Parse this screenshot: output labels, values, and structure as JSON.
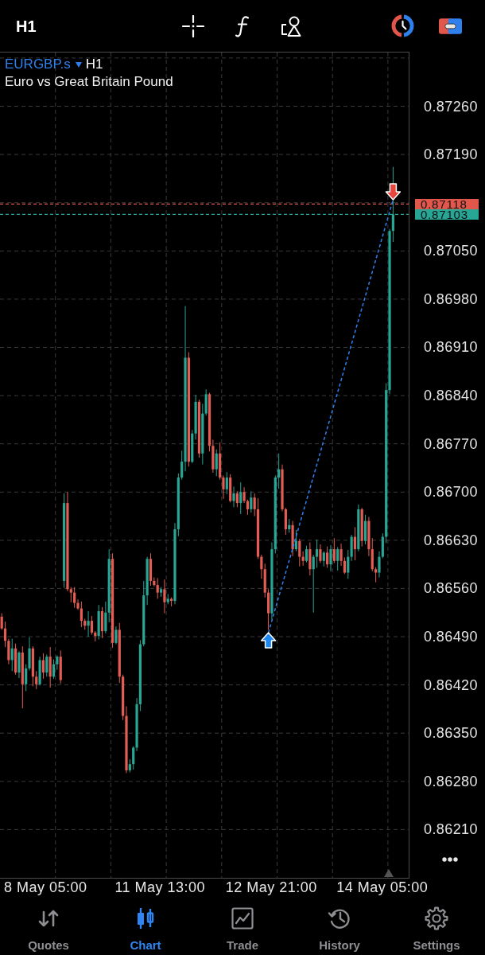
{
  "top_bar": {
    "timeframe": "H1"
  },
  "chart": {
    "symbol": "EURGBP.s",
    "timeframe": "H1",
    "description": "Euro vs Great Britain Pound",
    "chart_data": {
      "type": "candlestick",
      "grid": true,
      "ylim": [
        0.8614,
        0.87338
      ],
      "yticks": [
        {
          "value": 0.8726,
          "label": "0.87260"
        },
        {
          "value": 0.8719,
          "label": "0.87190"
        },
        {
          "value": 0.8705,
          "label": "0.87050"
        },
        {
          "value": 0.8698,
          "label": "0.86980"
        },
        {
          "value": 0.8691,
          "label": "0.86910"
        },
        {
          "value": 0.8684,
          "label": "0.86840"
        },
        {
          "value": 0.8677,
          "label": "0.86770"
        },
        {
          "value": 0.867,
          "label": "0.86700"
        },
        {
          "value": 0.8663,
          "label": "0.86630"
        },
        {
          "value": 0.8656,
          "label": "0.86560"
        },
        {
          "value": 0.8649,
          "label": "0.86490"
        },
        {
          "value": 0.8642,
          "label": "0.86420"
        },
        {
          "value": 0.8635,
          "label": "0.86350"
        },
        {
          "value": 0.8628,
          "label": "0.86280"
        },
        {
          "value": 0.8621,
          "label": "0.86210"
        }
      ],
      "ref_lines": [
        {
          "axis": "y",
          "value": 0.87118,
          "label": "0.87118",
          "color": "#e2574c"
        },
        {
          "axis": "y",
          "value": 0.87103,
          "label": "0.87103",
          "color": "#27a696"
        }
      ],
      "categories": [
        null,
        null,
        null,
        null,
        null,
        null,
        null,
        null,
        null,
        null,
        null,
        null,
        null,
        null,
        null,
        null,
        null,
        null,
        null,
        null,
        null,
        null,
        null,
        null,
        null,
        null,
        null,
        null,
        null,
        null,
        null,
        null,
        null,
        null,
        null,
        null,
        null,
        null,
        null,
        null,
        null,
        null,
        null,
        null,
        null,
        null,
        null,
        null,
        null,
        null,
        null,
        null,
        null,
        null,
        null,
        null,
        null,
        null,
        null,
        null,
        null,
        null,
        null,
        null,
        null,
        null,
        null,
        null,
        null,
        null,
        null,
        null,
        null,
        null,
        null,
        null,
        null,
        null,
        null,
        null,
        null,
        null,
        null,
        null,
        null,
        null,
        null,
        null,
        null,
        null,
        null,
        null,
        null,
        null,
        null,
        null,
        null,
        null,
        null,
        null,
        null,
        null,
        null,
        null,
        null,
        null,
        null,
        null,
        null,
        null,
        null,
        null,
        null,
        null,
        null,
        null,
        null,
        null
      ],
      "ohlc": [
        [
          0.86519,
          0.86524,
          0.865,
          0.86502
        ],
        [
          0.86502,
          0.86512,
          0.86475,
          0.86484
        ],
        [
          0.86484,
          0.86487,
          0.8645,
          0.86456
        ],
        [
          0.86456,
          0.86487,
          0.8644,
          0.86473
        ],
        [
          0.86473,
          0.8648,
          0.86435,
          0.86438
        ],
        [
          0.86438,
          0.86469,
          0.8643,
          0.86467
        ],
        [
          0.86467,
          0.86476,
          0.86386,
          0.86421
        ],
        [
          0.86421,
          0.8645,
          0.86411,
          0.86444
        ],
        [
          0.86444,
          0.86489,
          0.86441,
          0.86473
        ],
        [
          0.86473,
          0.86476,
          0.86418,
          0.86432
        ],
        [
          0.86432,
          0.8644,
          0.86414,
          0.86421
        ],
        [
          0.86421,
          0.86461,
          0.86419,
          0.86456
        ],
        [
          0.86456,
          0.86466,
          0.86429,
          0.86438
        ],
        [
          0.86438,
          0.86464,
          0.86432,
          0.86461
        ],
        [
          0.86461,
          0.86475,
          0.86416,
          0.86432
        ],
        [
          0.86432,
          0.86457,
          0.86429,
          0.8645
        ],
        [
          0.8645,
          0.86463,
          0.86442,
          0.86461
        ],
        [
          0.86461,
          0.8647,
          0.86422,
          0.86427
        ],
        [
          0.86571,
          0.86698,
          0.86561,
          0.86684
        ],
        [
          0.86684,
          0.867,
          0.86556,
          0.86559
        ],
        [
          0.86559,
          0.86562,
          0.8654,
          0.86554
        ],
        [
          0.86554,
          0.86562,
          0.86532,
          0.86539
        ],
        [
          0.86539,
          0.86544,
          0.86529,
          0.86531
        ],
        [
          0.86531,
          0.86541,
          0.86504,
          0.86513
        ],
        [
          0.86513,
          0.86516,
          0.865,
          0.86506
        ],
        [
          0.86506,
          0.86527,
          0.8649,
          0.86513
        ],
        [
          0.86513,
          0.8652,
          0.86493,
          0.86496
        ],
        [
          0.86496,
          0.86498,
          0.86483,
          0.86491
        ],
        [
          0.86491,
          0.86536,
          0.86486,
          0.86527
        ],
        [
          0.86527,
          0.86533,
          0.86488,
          0.86498
        ],
        [
          0.86498,
          0.86541,
          0.86495,
          0.86525
        ],
        [
          0.86525,
          0.86617,
          0.86511,
          0.86603
        ],
        [
          0.86603,
          0.86611,
          0.86474,
          0.86481
        ],
        [
          0.86481,
          0.86505,
          0.86479,
          0.865
        ],
        [
          0.865,
          0.8651,
          0.86423,
          0.86432
        ],
        [
          0.86432,
          0.86435,
          0.86369,
          0.86375
        ],
        [
          0.86375,
          0.86389,
          0.86292,
          0.86296
        ],
        [
          0.86296,
          0.86312,
          0.86293,
          0.86305
        ],
        [
          0.86305,
          0.86331,
          0.86297,
          0.86329
        ],
        [
          0.86329,
          0.86401,
          0.86324,
          0.86392
        ],
        [
          0.86392,
          0.86485,
          0.86382,
          0.86479
        ],
        [
          0.86479,
          0.86571,
          0.86476,
          0.8655
        ],
        [
          0.8655,
          0.86606,
          0.86536,
          0.86603
        ],
        [
          0.86603,
          0.86611,
          0.86564,
          0.86571
        ],
        [
          0.86571,
          0.86576,
          0.86563,
          0.86565
        ],
        [
          0.86565,
          0.86575,
          0.86545,
          0.86554
        ],
        [
          0.86554,
          0.86562,
          0.86548,
          0.86559
        ],
        [
          0.86559,
          0.86573,
          0.86524,
          0.8654
        ],
        [
          0.8654,
          0.86552,
          0.86537,
          0.86545
        ],
        [
          0.86545,
          0.86547,
          0.86534,
          0.86542
        ],
        [
          0.86542,
          0.86655,
          0.86537,
          0.86646
        ],
        [
          0.86646,
          0.86727,
          0.86636,
          0.86721
        ],
        [
          0.86721,
          0.8676,
          0.86718,
          0.86744
        ],
        [
          0.86744,
          0.8697,
          0.8673,
          0.86895
        ],
        [
          0.86895,
          0.86903,
          0.86737,
          0.86744
        ],
        [
          0.86744,
          0.8679,
          0.86742,
          0.86785
        ],
        [
          0.86785,
          0.86841,
          0.86776,
          0.86831
        ],
        [
          0.86831,
          0.86834,
          0.8675,
          0.86756
        ],
        [
          0.86756,
          0.86828,
          0.8674,
          0.86814
        ],
        [
          0.86814,
          0.86849,
          0.86811,
          0.86842
        ],
        [
          0.86842,
          0.86844,
          0.86759,
          0.86767
        ],
        [
          0.86767,
          0.86776,
          0.86728,
          0.86733
        ],
        [
          0.86733,
          0.86762,
          0.86723,
          0.86756
        ],
        [
          0.86756,
          0.86772,
          0.86718,
          0.86721
        ],
        [
          0.86721,
          0.86724,
          0.8669,
          0.86704
        ],
        [
          0.86704,
          0.86729,
          0.86697,
          0.86721
        ],
        [
          0.86721,
          0.86726,
          0.86685,
          0.86687
        ],
        [
          0.86687,
          0.86708,
          0.86678,
          0.86698
        ],
        [
          0.86698,
          0.86701,
          0.86678,
          0.86684
        ],
        [
          0.86684,
          0.86714,
          0.86668,
          0.867
        ],
        [
          0.867,
          0.86707,
          0.86684,
          0.86687
        ],
        [
          0.86687,
          0.86689,
          0.86667,
          0.86675
        ],
        [
          0.86675,
          0.86701,
          0.8667,
          0.86692
        ],
        [
          0.86692,
          0.86698,
          0.86665,
          0.86675
        ],
        [
          0.86675,
          0.86691,
          0.86603,
          0.86606
        ],
        [
          0.86606,
          0.86609,
          0.86574,
          0.86588
        ],
        [
          0.86588,
          0.86596,
          0.86547,
          0.86554
        ],
        [
          0.86554,
          0.86559,
          0.865,
          0.86524
        ],
        [
          0.86524,
          0.86627,
          0.86515,
          0.86617
        ],
        [
          0.86617,
          0.86724,
          0.86611,
          0.86721
        ],
        [
          0.86721,
          0.86756,
          0.86705,
          0.86733
        ],
        [
          0.86733,
          0.8674,
          0.86672,
          0.86675
        ],
        [
          0.86675,
          0.86677,
          0.86638,
          0.86646
        ],
        [
          0.86646,
          0.86661,
          0.86641,
          0.86652
        ],
        [
          0.86652,
          0.86658,
          0.86607,
          0.86617
        ],
        [
          0.86617,
          0.86645,
          0.86614,
          0.86629
        ],
        [
          0.86629,
          0.86632,
          0.86592,
          0.86606
        ],
        [
          0.86606,
          0.86614,
          0.86593,
          0.866
        ],
        [
          0.866,
          0.86622,
          0.86598,
          0.86617
        ],
        [
          0.86617,
          0.86627,
          0.86579,
          0.86588
        ],
        [
          0.86588,
          0.86609,
          0.86525,
          0.86606
        ],
        [
          0.86606,
          0.86631,
          0.8659,
          0.86617
        ],
        [
          0.86617,
          0.86624,
          0.86597,
          0.866
        ],
        [
          0.866,
          0.86614,
          0.86592,
          0.86612
        ],
        [
          0.86612,
          0.86621,
          0.8659,
          0.86595
        ],
        [
          0.86595,
          0.86623,
          0.86585,
          0.86617
        ],
        [
          0.86617,
          0.86633,
          0.86597,
          0.866
        ],
        [
          0.866,
          0.8662,
          0.86586,
          0.86617
        ],
        [
          0.86617,
          0.86625,
          0.86593,
          0.866
        ],
        [
          0.866,
          0.86605,
          0.86581,
          0.86583
        ],
        [
          0.86583,
          0.86616,
          0.86574,
          0.86606
        ],
        [
          0.86606,
          0.86638,
          0.866,
          0.86635
        ],
        [
          0.86635,
          0.86649,
          0.86601,
          0.86617
        ],
        [
          0.86617,
          0.86682,
          0.86614,
          0.86675
        ],
        [
          0.86675,
          0.86677,
          0.86621,
          0.86629
        ],
        [
          0.86629,
          0.86667,
          0.86624,
          0.86658
        ],
        [
          0.86658,
          0.86664,
          0.86607,
          0.86617
        ],
        [
          0.86617,
          0.86633,
          0.86585,
          0.86588
        ],
        [
          0.86588,
          0.86591,
          0.86569,
          0.86583
        ],
        [
          0.86583,
          0.86614,
          0.86576,
          0.86606
        ],
        [
          0.86606,
          0.8664,
          0.86604,
          0.86635
        ],
        [
          0.86635,
          0.86858,
          0.86626,
          0.86848
        ],
        [
          0.86848,
          0.87082,
          0.86842,
          0.87079
        ],
        [
          0.87079,
          0.87172,
          0.87063,
          0.87103
        ],
        null,
        null,
        null,
        null
      ]
    },
    "time_labels": [
      "8 May 05:00",
      "11 May 13:00",
      "12 May 21:00",
      "14 May 05:00"
    ]
  },
  "tab_bar": [
    {
      "label": "Quotes",
      "selected": false
    },
    {
      "label": "Chart",
      "selected": true
    },
    {
      "label": "Trade",
      "selected": false
    },
    {
      "label": "History",
      "selected": false
    },
    {
      "label": "Settings",
      "selected": false
    }
  ]
}
